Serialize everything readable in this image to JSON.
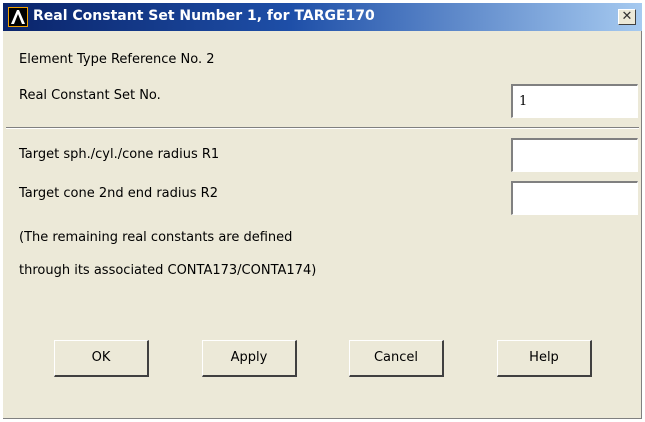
{
  "window": {
    "title": "Real Constant Set Number 1, for TARGE170",
    "close_glyph": "✕"
  },
  "header": {
    "element_type": "Element Type Reference No. 2",
    "set_no_label": "Real Constant Set No.",
    "set_no_value": "1"
  },
  "fields": [
    {
      "label": "Target sph./cyl./cone radius  R1",
      "value": ""
    },
    {
      "label": "Target cone 2nd end radius    R2",
      "value": ""
    }
  ],
  "notes": [
    "(The remaining real constants are defined",
    "through its associated CONTA173/CONTA174)"
  ],
  "buttons": {
    "ok": "OK",
    "apply": "Apply",
    "cancel": "Cancel",
    "help": "Help"
  }
}
